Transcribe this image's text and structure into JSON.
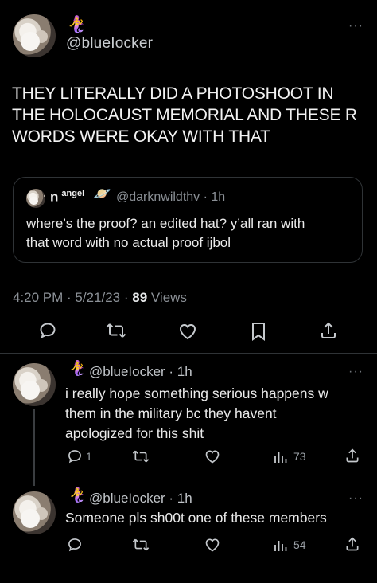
{
  "main_tweet": {
    "emoji": "🧜‍♀️",
    "handle": "@blueIocker",
    "more": "···",
    "text_line1": "THEY LITERALLY DID A PHOTOSHOOT  IN",
    "text_line2": "THE HOLOCAUST MEMORIAL AND THESE R",
    "text_line3": "WORDS WERE OKAY WITH THAT",
    "timestamp": "4:20 PM · 5/21/23 · ",
    "views_count": "89",
    "views_label": " Views"
  },
  "quoted_tweet": {
    "display_name": "n",
    "display_name_sup": "angel",
    "emoji": "🪐",
    "handle_time": "@darknwildthv · 1h",
    "text_line1": "where’s the proof? an edited hat? y’all ran with",
    "text_line2": "that word with no actual proof ijbol"
  },
  "replies": [
    {
      "emoji": "🧜‍♀️",
      "handle_time": "@blueIocker · 1h",
      "more": "···",
      "text_line1": "i really hope something serious happens w",
      "text_line2": "them in the military bc they havent",
      "text_line3": "apologized for this shit",
      "reply_count": "1",
      "views": "73"
    },
    {
      "emoji": "🧜‍♀️",
      "handle_time": "@blueIocker · 1h",
      "more": "···",
      "text_line1": "Someone pls sh00t one of these members",
      "reply_count": "",
      "views": "54"
    }
  ],
  "colors": {
    "background": "#000000",
    "text": "#e7e9ea",
    "muted": "#71767b",
    "border": "#2f3336"
  },
  "icons": [
    "comment-icon",
    "retweet-icon",
    "like-icon",
    "bookmark-icon",
    "share-icon",
    "views-icon",
    "more-icon"
  ]
}
